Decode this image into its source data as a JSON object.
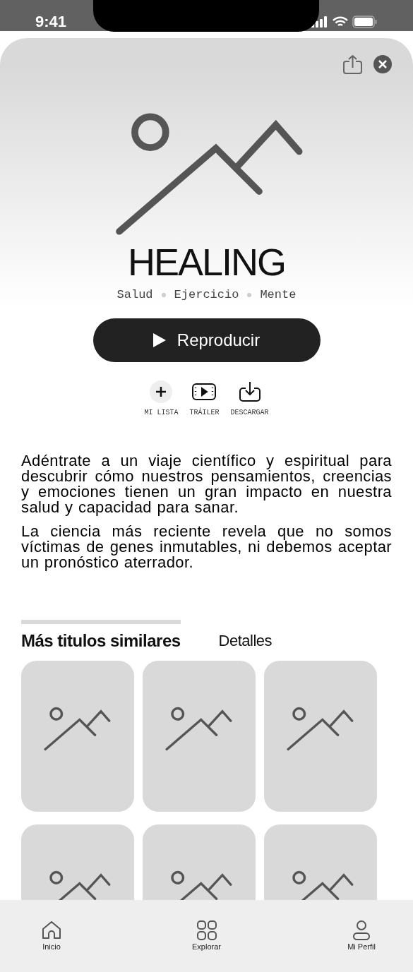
{
  "status_bar": {
    "time": "9:41"
  },
  "hero": {
    "title": "HEALING",
    "tags": [
      "Salud",
      "Ejercicio",
      "Mente"
    ]
  },
  "play_button": {
    "label": "Reproducir"
  },
  "actions": [
    {
      "kind": "add",
      "label": "MI LISTA"
    },
    {
      "kind": "trailer",
      "label": "TRÁILER"
    },
    {
      "kind": "download",
      "label": "DESCARGAR"
    }
  ],
  "description": [
    "Adéntrate a un viaje científico y espiritual para descubrir cómo nuestros pensamientos, creencias y emociones tienen un gran impacto en nuestra salud y capacidad para sanar.",
    "La ciencia más reciente revela que no somos víctimas de genes inmutables, ni debemos aceptar un pronóstico aterrador."
  ],
  "tabs": [
    {
      "label": "Más titulos similares",
      "selected": true
    },
    {
      "label": "Detalles",
      "selected": false
    }
  ],
  "similar_titles": [
    {
      "kind": "placeholder"
    },
    {
      "kind": "placeholder"
    },
    {
      "kind": "placeholder"
    },
    {
      "kind": "placeholder"
    },
    {
      "kind": "placeholder"
    },
    {
      "kind": "placeholder"
    }
  ],
  "bottom_nav": [
    {
      "kind": "home",
      "label": "Inicio"
    },
    {
      "kind": "explore",
      "label": "Explorar"
    },
    {
      "kind": "profile",
      "label": "Mi Perfil"
    }
  ]
}
